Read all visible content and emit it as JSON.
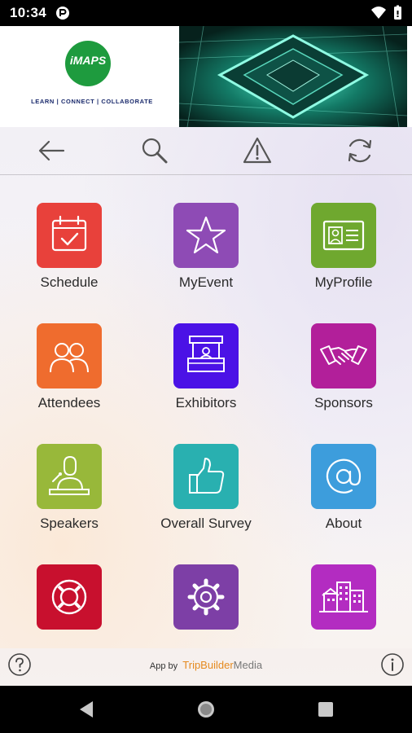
{
  "status_bar": {
    "time": "10:34"
  },
  "banner": {
    "logo_text": "iMAPS",
    "tagline": "LEARN | CONNECT | COLLABORATE"
  },
  "toolbar": {
    "items": [
      "back-arrow-icon",
      "search-icon",
      "alert-icon",
      "refresh-icon"
    ]
  },
  "menu": {
    "tiles": [
      {
        "label": "Schedule",
        "icon": "calendar-check-icon",
        "color": "#e8413b"
      },
      {
        "label": "MyEvent",
        "icon": "star-icon",
        "color": "#8e4bb5"
      },
      {
        "label": "MyProfile",
        "icon": "id-card-icon",
        "color": "#6fa82f"
      },
      {
        "label": "Attendees",
        "icon": "people-icon",
        "color": "#ef6c2e"
      },
      {
        "label": "Exhibitors",
        "icon": "booth-icon",
        "color": "#4b12e6"
      },
      {
        "label": "Sponsors",
        "icon": "handshake-icon",
        "color": "#b21f9a"
      },
      {
        "label": "Speakers",
        "icon": "speaker-podium-icon",
        "color": "#98b83a"
      },
      {
        "label": "Overall Survey",
        "icon": "thumbs-up-icon",
        "color": "#29b0b0"
      },
      {
        "label": "About",
        "icon": "at-sign-icon",
        "color": "#3d9ddc"
      },
      {
        "label": "",
        "icon": "lifebuoy-icon",
        "color": "#c8102e"
      },
      {
        "label": "",
        "icon": "gear-icon",
        "color": "#7d3fa6"
      },
      {
        "label": "",
        "icon": "buildings-icon",
        "color": "#b32cc1"
      }
    ]
  },
  "footer": {
    "app_by": "App by",
    "brand_a": "TripBuilder",
    "brand_b": "Media"
  },
  "colors": {
    "status_bar": "#000000",
    "nav_bar": "#000000",
    "icon_stroke": "#555555"
  }
}
